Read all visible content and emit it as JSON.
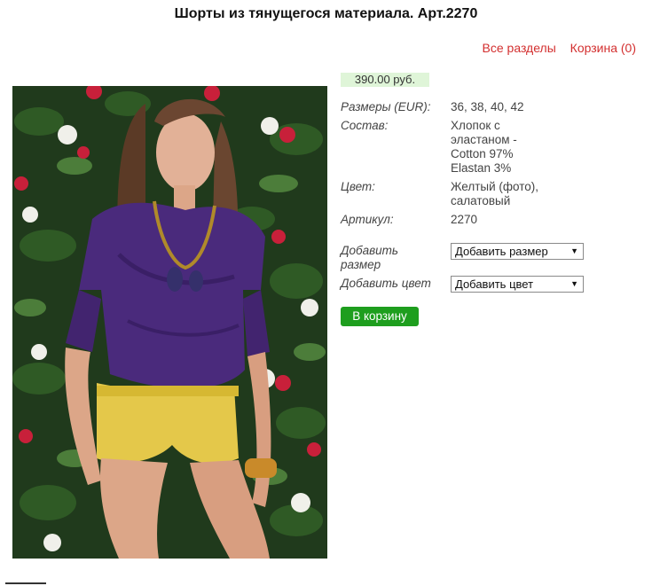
{
  "page": {
    "title": "Шорты из тянущегося материала. Арт.2270"
  },
  "nav": {
    "sections_link": "Все разделы",
    "cart_link": "Корзина (0)"
  },
  "product": {
    "price": "390.00 руб.",
    "sizes_label": "Размеры (EUR):",
    "sizes_value": "36, 38, 40, 42",
    "composition_label": "Состав:",
    "composition_lines": [
      "Хлопок с",
      "эластаном -",
      "Cotton 97%",
      "Elastan 3%"
    ],
    "color_label": "Цвет:",
    "color_lines": [
      "Желтый (фото),",
      "салатовый"
    ],
    "article_label": "Артикул:",
    "article_value": "2270",
    "add_size_label_lines": [
      "Добавить",
      "размер"
    ],
    "add_size_select": "Добавить размер",
    "add_color_label": "Добавить цвет",
    "add_color_select": "Добавить цвет",
    "cart_button": "В корзину"
  },
  "colors": {
    "link": "#d32f2f",
    "price_bg": "#dff5d8",
    "button_bg": "#1e9e1e"
  },
  "icons": {
    "select_arrow": "chevron-down-icon"
  }
}
